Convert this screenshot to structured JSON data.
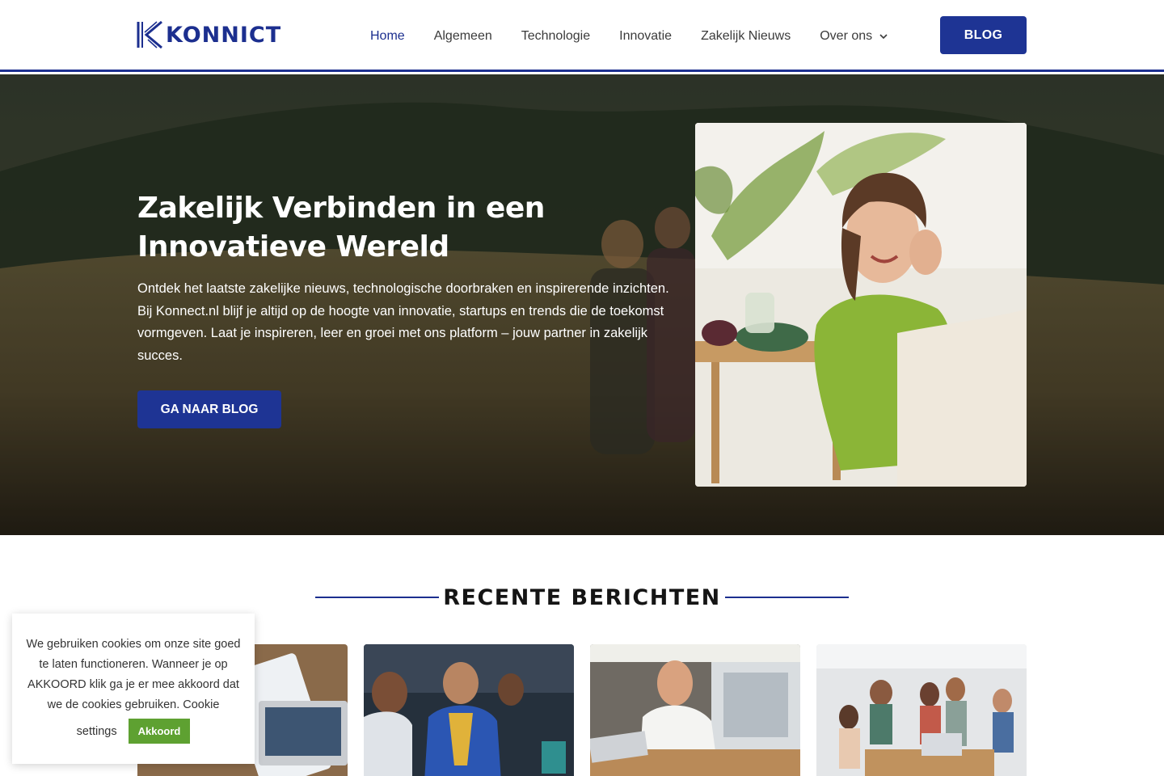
{
  "brand": {
    "logo_text": "KONNICT",
    "primary_color": "#1e3494",
    "accent_green": "#5ea131"
  },
  "nav": {
    "items": [
      {
        "label": "Home",
        "active": true
      },
      {
        "label": "Algemeen"
      },
      {
        "label": "Technologie"
      },
      {
        "label": "Innovatie"
      },
      {
        "label": "Zakelijk Nieuws"
      },
      {
        "label": "Over ons",
        "icon": "chevron-down-icon"
      }
    ],
    "blog_button": "BLOG"
  },
  "hero": {
    "title": "Zakelijk Verbinden in een Innovatieve Wereld",
    "text": "Ontdek het laatste zakelijke nieuws, technologische doorbraken en inspirerende inzichten. Bij Konnect.nl blijf je altijd op de hoogte van innovatie, startups en trends die de toekomst vormgeven. Laat je inspireren, leer en groei met ons platform – jouw partner in zakelijk succes.",
    "button": "GA NAAR BLOG"
  },
  "recent": {
    "title": "RECENTE BERICHTEN"
  },
  "cookie": {
    "text": "We gebruiken cookies om onze site goed te laten functioneren. Wanneer je op AKKOORD klik ga je er mee akkoord dat we de cookies gebruiken. Cookie",
    "settings_label": "settings",
    "accept_button": "Akkoord"
  }
}
